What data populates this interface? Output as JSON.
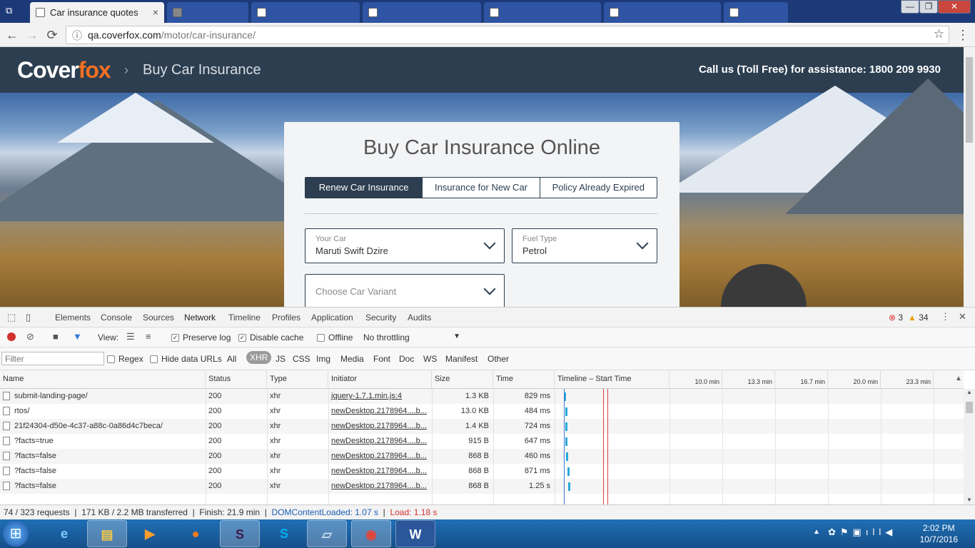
{
  "browser": {
    "active_tab": {
      "title": "Car insurance quotes",
      "close": "×"
    },
    "inactive_tabs": [
      "",
      "",
      "",
      "",
      "",
      "",
      "",
      ""
    ],
    "window_controls": {
      "minimize": "—",
      "maximize": "❐",
      "close": "✕"
    },
    "nav": {
      "back": "←",
      "forward": "→",
      "reload": "⟳",
      "info": "ⓘ",
      "star": "☆",
      "menu": "⋮"
    },
    "url": {
      "host": "qa.coverfox.com",
      "path": "/motor/car-insurance/"
    }
  },
  "site": {
    "logo_main": "Cover",
    "logo_accent": "fox",
    "breadcrumb_sep": "›",
    "breadcrumb": "Buy Car Insurance",
    "callus": "Call us (Toll Free) for assistance: 1800 209 9930",
    "card": {
      "title": "Buy Car Insurance Online",
      "segments": [
        "Renew Car Insurance",
        "Insurance for New Car",
        "Policy Already Expired"
      ],
      "selected_segment": 0,
      "your_car": {
        "label": "Your Car",
        "value": "Maruti Swift Dzire"
      },
      "fuel_type": {
        "label": "Fuel Type",
        "value": "Petrol"
      },
      "variant": {
        "placeholder": "Choose Car Variant"
      }
    }
  },
  "devtools": {
    "tabs": [
      "Elements",
      "Console",
      "Sources",
      "Network",
      "Timeline",
      "Profiles",
      "Application",
      "Security",
      "Audits"
    ],
    "active_tab": "Network",
    "errors": "3",
    "warnings": "34",
    "toolbar": {
      "view_label": "View:",
      "preserve_log": "Preserve log",
      "disable_cache": "Disable cache",
      "offline": "Offline",
      "throttling": "No throttling"
    },
    "filter": {
      "placeholder": "Filter",
      "regex": "Regex",
      "hide_data_urls": "Hide data URLs",
      "types": [
        "All",
        "XHR",
        "JS",
        "CSS",
        "Img",
        "Media",
        "Font",
        "Doc",
        "WS",
        "Manifest",
        "Other"
      ],
      "active_type": "XHR"
    },
    "columns": {
      "name": "Name",
      "status": "Status",
      "type": "Type",
      "initiator": "Initiator",
      "size": "Size",
      "time": "Time",
      "timeline": "Timeline – Start Time"
    },
    "timeline_ticks": [
      "10.0 min",
      "13.3 min",
      "16.7 min",
      "20.0 min",
      "23.3 min"
    ],
    "requests": [
      {
        "name": "submit-landing-page/",
        "status": "200",
        "type": "xhr",
        "initiator": "jquery-1.7.1.min.js:4",
        "size": "1.3 KB",
        "time": "829 ms"
      },
      {
        "name": "rtos/",
        "status": "200",
        "type": "xhr",
        "initiator": "newDesktop.2178964....b...",
        "size": "13.0 KB",
        "time": "484 ms"
      },
      {
        "name": "21f24304-d50e-4c37-a88c-0a86d4c7beca/",
        "status": "200",
        "type": "xhr",
        "initiator": "newDesktop.2178964....b...",
        "size": "1.4 KB",
        "time": "724 ms"
      },
      {
        "name": "?facts=true",
        "status": "200",
        "type": "xhr",
        "initiator": "newDesktop.2178964....b...",
        "size": "915 B",
        "time": "647 ms"
      },
      {
        "name": "?facts=false",
        "status": "200",
        "type": "xhr",
        "initiator": "newDesktop.2178964....b...",
        "size": "868 B",
        "time": "460 ms"
      },
      {
        "name": "?facts=false",
        "status": "200",
        "type": "xhr",
        "initiator": "newDesktop.2178964....b...",
        "size": "868 B",
        "time": "871 ms"
      },
      {
        "name": "?facts=false",
        "status": "200",
        "type": "xhr",
        "initiator": "newDesktop.2178964....b...",
        "size": "868 B",
        "time": "1.25 s"
      }
    ],
    "status_bar": {
      "requests": "74 / 323 requests",
      "transferred": "171 KB / 2.2 MB transferred",
      "finish": "Finish: 21.9 min",
      "dom_loaded": "DOMContentLoaded: 1.07 s",
      "load": "Load: 1.18 s"
    }
  },
  "taskbar": {
    "start": "⊞",
    "apps": [
      "Internet Explorer",
      "Windows Explorer",
      "Media Player",
      "Firefox",
      "Slack",
      "Skype",
      "Notepad",
      "Chrome",
      "Word"
    ],
    "clock_time": "2:02 PM",
    "clock_date": "10/7/2016"
  },
  "colors": {
    "header": "#2c3e50",
    "accent": "#f36f21",
    "devtools_blue": "#3879d9",
    "taskbar": "#1f6fb5"
  }
}
